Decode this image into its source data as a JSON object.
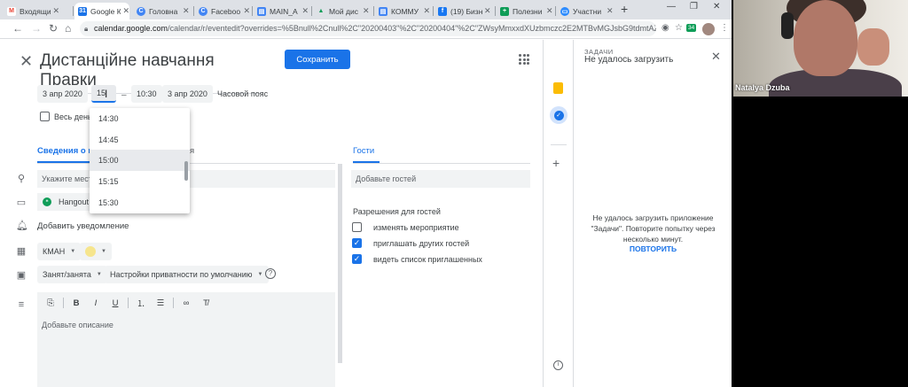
{
  "browser": {
    "tabs": [
      {
        "label": "Входящи",
        "fav_letter": "M",
        "fav_color": "#ea4335"
      },
      {
        "label": "Google К",
        "fav_letter": "31",
        "fav_color": "#1a73e8"
      },
      {
        "label": "Головна",
        "fav_letter": "C",
        "fav_color": "#4285f4"
      },
      {
        "label": "Faceboo",
        "fav_letter": "C",
        "fav_color": "#4285f4"
      },
      {
        "label": "MAIN_A",
        "fav_letter": "▤",
        "fav_color": "#4285f4"
      },
      {
        "label": "Мой дис",
        "fav_letter": "▲",
        "fav_color": "#0f9d58"
      },
      {
        "label": "КОММУ",
        "fav_letter": "▤",
        "fav_color": "#4285f4"
      },
      {
        "label": "(19) Бизн",
        "fav_letter": "f",
        "fav_color": "#1877f2"
      },
      {
        "label": "Полезни",
        "fav_letter": "+",
        "fav_color": "#0f9d58"
      },
      {
        "label": "Участни",
        "fav_letter": "▭",
        "fav_color": "#2d8cff"
      }
    ],
    "new_tab": "+",
    "url_host": "calendar.google.com",
    "url_path": "/calendar/r/eventedit?overrides=%5Bnull%2Cnull%2C\"20200403\"%2C\"20200404\"%2C\"ZWsyMmxxdXUzbmczc2E2MTBvMGJsbG9tdmtAZ3...",
    "counter_badge": "34"
  },
  "event": {
    "title": "Дистанційне навчання Правки",
    "save_label": "Сохранить",
    "start_date": "3 апр 2020",
    "start_time": "15",
    "dash": "–",
    "end_time": "10:30",
    "end_date": "3 апр 2020",
    "timezone_label": "Часовой пояс",
    "all_day_label": "Весь день",
    "time_options": [
      "14:30",
      "14:45",
      "15:00",
      "15:15",
      "15:30"
    ],
    "selected_time": "15:00"
  },
  "details": {
    "tab_details": "Сведения о ме",
    "tab_find_time": "я",
    "location_placeholder": "Укажите мест",
    "hangouts_label": "Hangout",
    "add_notification": "Добавить уведомление",
    "calendar_owner": "КМАН",
    "busy_label": "Занят/занята",
    "privacy_label": "Настройки приватности по умолчанию",
    "description_placeholder": "Добавьте описание",
    "format_buttons": [
      "B",
      "I",
      "U"
    ]
  },
  "guests": {
    "tab_label": "Гости",
    "input_placeholder": "Добавьте гостей",
    "permissions_title": "Разрешения для гостей",
    "permissions": [
      {
        "label": "изменять мероприятие",
        "checked": false
      },
      {
        "label": "приглашать других гостей",
        "checked": true
      },
      {
        "label": "видеть список приглашенных",
        "checked": true
      }
    ]
  },
  "tasks_panel": {
    "heading": "ЗАДАЧИ",
    "subtitle": "Не удалось загрузить",
    "error_message": "Не удалось загрузить приложение \"Задачи\". Повторите попытку через несколько минут.",
    "retry_label": "ПОВТОРИТЬ"
  },
  "video": {
    "participant_name": "Natalya Dzuba"
  }
}
